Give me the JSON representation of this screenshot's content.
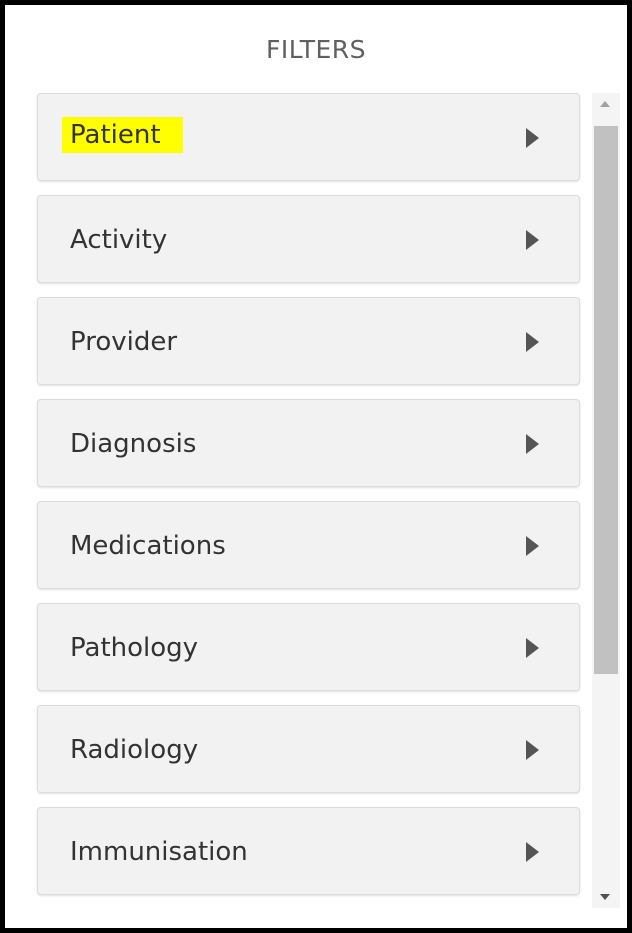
{
  "panel": {
    "title": "FILTERS"
  },
  "filters": {
    "items": [
      {
        "label": "Patient",
        "highlighted": true
      },
      {
        "label": "Activity"
      },
      {
        "label": "Provider"
      },
      {
        "label": "Diagnosis"
      },
      {
        "label": "Medications"
      },
      {
        "label": "Pathology"
      },
      {
        "label": "Radiology"
      },
      {
        "label": "Immunisation"
      }
    ]
  },
  "icons": {
    "item_arrow": "caret-right-icon",
    "scroll_up": "scroll-up-arrow-icon",
    "scroll_down": "scroll-down-arrow-icon"
  },
  "colors": {
    "highlight": "#ffff00",
    "item_background": "#f2f2f2",
    "text": "#333333",
    "title": "#606060"
  }
}
